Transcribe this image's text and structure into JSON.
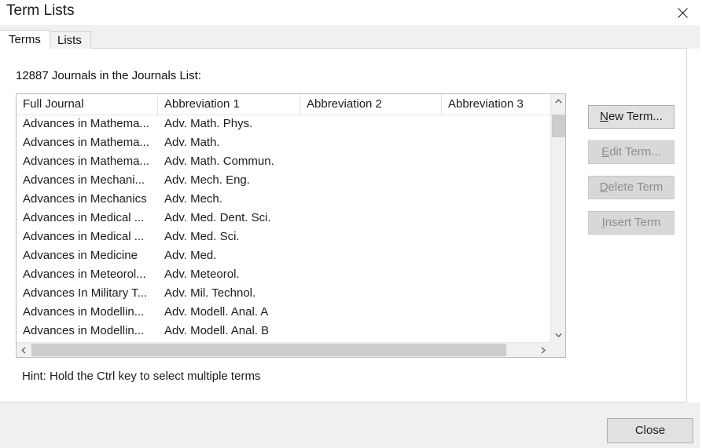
{
  "window": {
    "title": "Term Lists",
    "close_icon": "close-x-icon"
  },
  "tabs": [
    {
      "label": "Terms",
      "active": true
    },
    {
      "label": "Lists",
      "active": false
    }
  ],
  "main": {
    "count_label": "12887 Journals in the Journals List:",
    "hint": "Hint: Hold the Ctrl key to select multiple terms"
  },
  "list": {
    "columns": [
      "Full Journal",
      "Abbreviation 1",
      "Abbreviation 2",
      "Abbreviation 3"
    ],
    "rows": [
      [
        "Advances in Mathema...",
        "Adv. Math. Phys.",
        "",
        ""
      ],
      [
        "Advances in Mathema...",
        "Adv. Math.",
        "",
        ""
      ],
      [
        "Advances in Mathema...",
        "Adv. Math. Commun.",
        "",
        ""
      ],
      [
        "Advances in Mechani...",
        "Adv. Mech. Eng.",
        "",
        ""
      ],
      [
        "Advances in Mechanics",
        "Adv. Mech.",
        "",
        ""
      ],
      [
        "Advances in Medical ...",
        "Adv. Med. Dent. Sci.",
        "",
        ""
      ],
      [
        "Advances in Medical ...",
        "Adv. Med. Sci.",
        "",
        ""
      ],
      [
        "Advances in Medicine",
        "Adv. Med.",
        "",
        ""
      ],
      [
        "Advances in Meteorol...",
        "Adv. Meteorol.",
        "",
        ""
      ],
      [
        "Advances In Military T...",
        "Adv. Mil. Technol.",
        "",
        ""
      ],
      [
        "Advances in Modellin...",
        "Adv. Modell. Anal. A",
        "",
        ""
      ],
      [
        "Advances in Modellin...",
        "Adv. Modell. Anal. B",
        "",
        ""
      ]
    ],
    "vertical_scrollbar": {
      "up_arrow": "chevron-up-icon",
      "down_arrow": "chevron-down-icon"
    },
    "horizontal_scrollbar": {
      "left_arrow": "chevron-left-icon",
      "right_arrow": "chevron-right-icon"
    }
  },
  "side_buttons": [
    {
      "id": "new",
      "label": "New Term...",
      "accel": "N",
      "rest": "ew Term...",
      "enabled": true
    },
    {
      "id": "edit",
      "label": "Edit Term...",
      "accel": "E",
      "rest": "dit Term...",
      "enabled": false
    },
    {
      "id": "delete",
      "label": "Delete Term",
      "accel": "D",
      "rest": "elete Term",
      "enabled": false
    },
    {
      "id": "insert",
      "label": "Insert Term",
      "accel": "I",
      "rest": "nsert Term",
      "enabled": false
    }
  ],
  "footer": {
    "close_label": "Close"
  },
  "colors": {
    "window_bg": "#ffffff",
    "tabstrip_bg": "#f0f0f0",
    "footer_bg": "#f0f0f0",
    "button_face": "#e1e1e1",
    "button_border": "#adadad",
    "disabled_text": "#8d8d8d",
    "scroll_track": "#f0f0f0",
    "scroll_thumb": "#cdcdcd",
    "list_border": "#bcbcbc",
    "text": "#1c1c1c"
  }
}
